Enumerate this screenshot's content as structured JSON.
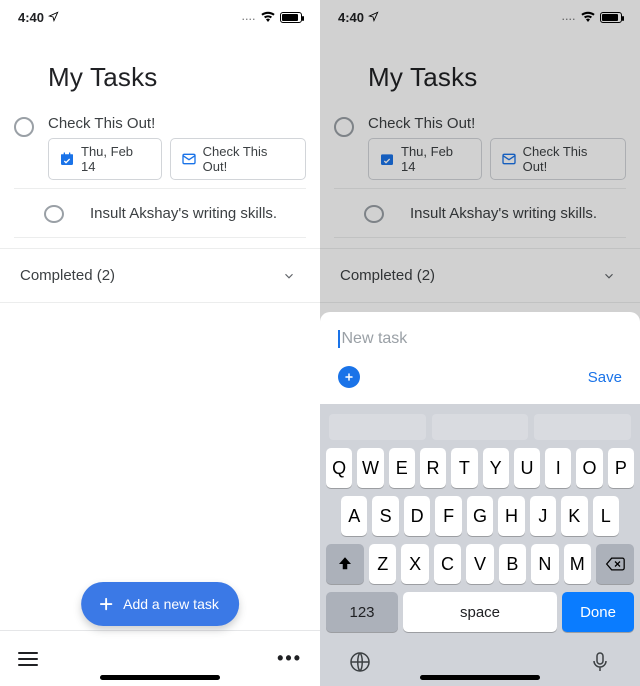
{
  "status": {
    "time": "4:40"
  },
  "title": "My Tasks",
  "task1": {
    "title": "Check This Out!",
    "date_chip": "Thu, Feb 14",
    "mail_chip": "Check This Out!"
  },
  "task2": {
    "title": "Insult Akshay's writing skills."
  },
  "completed_label": "Completed (2)",
  "fab_label": "Add a new task",
  "sheet": {
    "placeholder": "New task",
    "save": "Save"
  },
  "kbd": {
    "r1": [
      "Q",
      "W",
      "E",
      "R",
      "T",
      "Y",
      "U",
      "I",
      "O",
      "P"
    ],
    "r2": [
      "A",
      "S",
      "D",
      "F",
      "G",
      "H",
      "J",
      "K",
      "L"
    ],
    "r3": [
      "Z",
      "X",
      "C",
      "V",
      "B",
      "N",
      "M"
    ],
    "k123": "123",
    "space": "space",
    "done": "Done"
  }
}
